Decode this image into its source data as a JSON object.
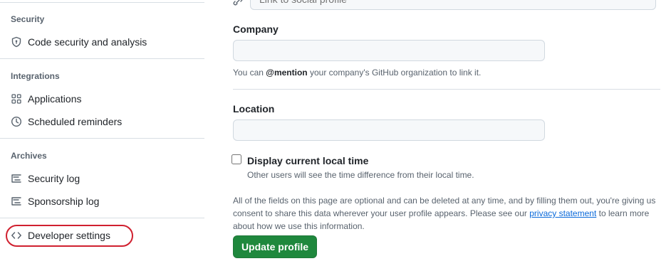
{
  "sidebar": {
    "sections": [
      {
        "title": "Security",
        "items": [
          {
            "label": "Code security and analysis",
            "icon": "shield-icon"
          }
        ]
      },
      {
        "title": "Integrations",
        "items": [
          {
            "label": "Applications",
            "icon": "apps-grid-icon"
          },
          {
            "label": "Scheduled reminders",
            "icon": "clock-icon"
          }
        ]
      },
      {
        "title": "Archives",
        "items": [
          {
            "label": "Security log",
            "icon": "log-icon"
          },
          {
            "label": "Sponsorship log",
            "icon": "log-icon"
          }
        ]
      }
    ],
    "developer_settings": {
      "label": "Developer settings",
      "icon": "code-icon"
    },
    "highlight_color": "#d0202f"
  },
  "form": {
    "social_placeholder": "Link to social profile",
    "company": {
      "label": "Company",
      "value": "",
      "hint_prefix": "You can ",
      "hint_mention": "@mention",
      "hint_suffix": " your company's GitHub organization to link it."
    },
    "location": {
      "label": "Location",
      "value": ""
    },
    "local_time": {
      "label": "Display current local time",
      "checked": false,
      "hint": "Other users will see the time difference from their local time."
    },
    "disclaimer": {
      "line1": "All of the fields on this page are optional and can be deleted at any time, and by filling them out, you're giving us",
      "line2_prefix": "consent to share this data wherever your user profile appears. Please see our ",
      "link": "privacy statement",
      "line2_suffix": " to learn more",
      "line3": "about how we use this information."
    },
    "submit_label": "Update profile"
  }
}
